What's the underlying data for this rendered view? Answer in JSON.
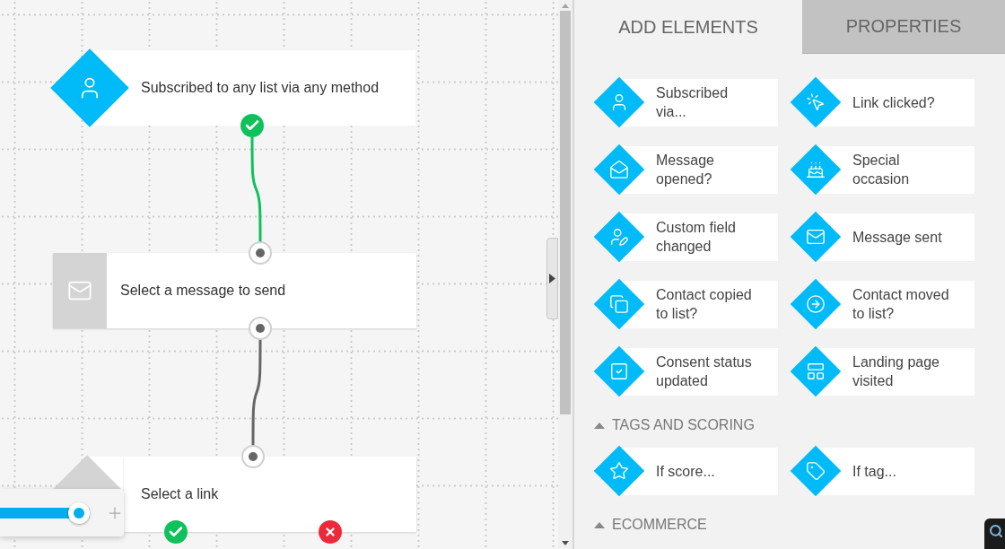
{
  "canvas": {
    "nodes": [
      {
        "kind": "trigger",
        "label": "Subscribed to any list via any method"
      },
      {
        "kind": "action",
        "label": "Select a message to send"
      },
      {
        "kind": "condition",
        "label": "Select a link"
      }
    ],
    "edges": [
      {
        "kind": "yes"
      },
      {
        "kind": "plain"
      }
    ],
    "zoom": {
      "level": 0.88
    }
  },
  "panel": {
    "tabs": [
      {
        "label": "ADD ELEMENTS",
        "selected": true
      },
      {
        "label": "PROPERTIES",
        "selected": false
      }
    ],
    "items": [
      {
        "label": "Subscribed via..."
      },
      {
        "label": "Link clicked?"
      },
      {
        "label": "Message opened?"
      },
      {
        "label": "Special occasion"
      },
      {
        "label": "Custom field changed"
      },
      {
        "label": "Message sent"
      },
      {
        "label": "Contact copied to list?"
      },
      {
        "label": "Contact moved to list?"
      },
      {
        "label": "Consent status updated"
      },
      {
        "label": "Landing page visited"
      }
    ],
    "sections": [
      {
        "title": "TAGS AND SCORING",
        "expanded": true,
        "items": [
          {
            "label": "If score..."
          },
          {
            "label": "If tag..."
          }
        ]
      },
      {
        "title": "ECOMMERCE",
        "expanded": true
      }
    ]
  }
}
